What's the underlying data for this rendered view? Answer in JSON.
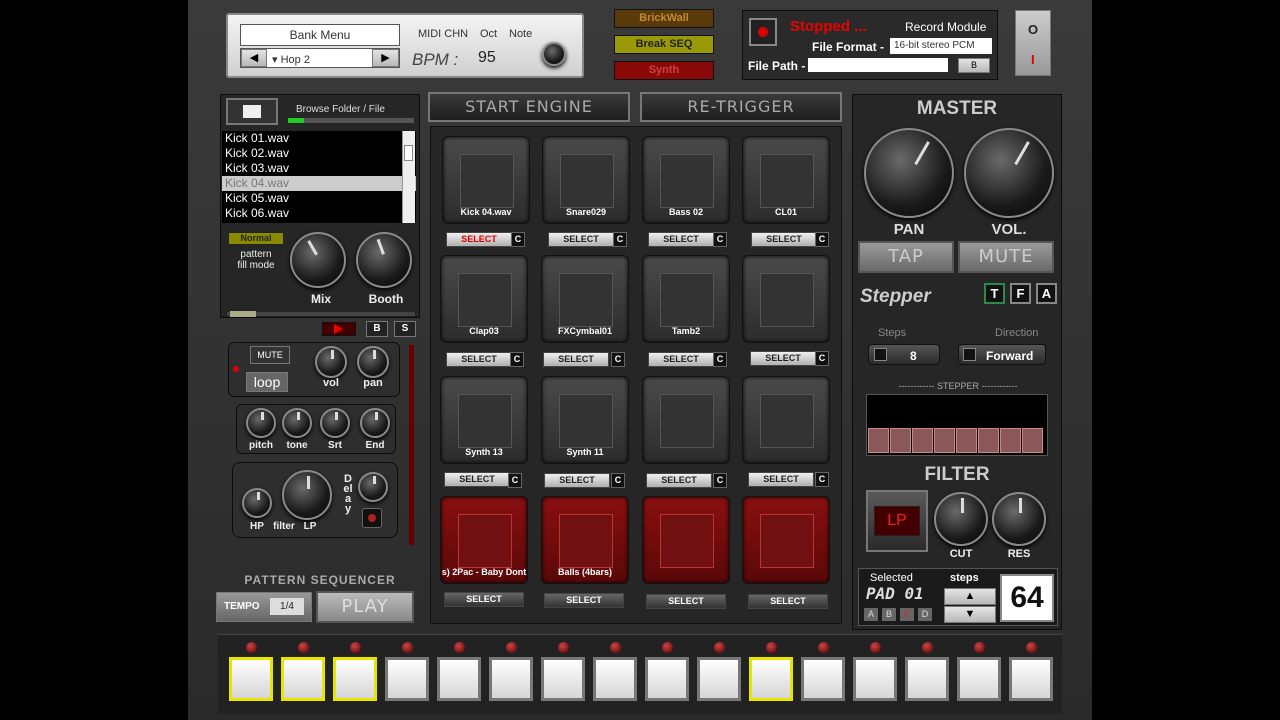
{
  "header": {
    "bank_menu": "Bank Menu",
    "preset": "Hop 2",
    "midi_chn": "MIDI CHN",
    "oct": "Oct",
    "note": "Note",
    "bpm_label": "BPM :",
    "bpm_value": "95",
    "modes": [
      "BrickWall",
      "Break SEQ",
      "Synth"
    ],
    "record_status": "Stopped ...",
    "record_module": "Record Module",
    "file_format_label": "File Format -",
    "file_format_value": "16-bit stereo PCM",
    "file_path_label": "File Path -",
    "file_path_value": "",
    "file_path_btn": "B",
    "power_o": "O",
    "power_i": "I"
  },
  "browser": {
    "browse_label": "Browse Folder / File",
    "files": [
      "Kick 01.wav",
      "Kick 02.wav",
      "Kick 03.wav",
      "Kick 04.wav",
      "Kick 05.wav",
      "Kick 06.wav"
    ],
    "selected_index": 3,
    "fill_mode_value": "Normal",
    "fill_mode_label_1": "pattern",
    "fill_mode_label_2": "fill mode",
    "mix": "Mix",
    "booth": "Booth"
  },
  "sample": {
    "b": "B",
    "s": "S",
    "mute": "MUTE",
    "loop": "loop",
    "vol": "vol",
    "pan": "pan",
    "pitch": "pitch",
    "tone": "tone",
    "srt": "Srt",
    "end": "End",
    "hp": "HP",
    "filter": "filter",
    "lp": "LP",
    "delay": "Delay"
  },
  "transport": {
    "start_engine": "START ENGINE",
    "retrigger": "RE-TRIGGER"
  },
  "pads": [
    {
      "name": "Kick 04.wav",
      "select": "SELECT",
      "c": "C",
      "active": true
    },
    {
      "name": "Snare029",
      "select": "SELECT",
      "c": "C"
    },
    {
      "name": "Bass 02",
      "select": "SELECT",
      "c": "C"
    },
    {
      "name": "CL01",
      "select": "SELECT",
      "c": "C"
    },
    {
      "name": "Clap03",
      "select": "SELECT",
      "c": "C"
    },
    {
      "name": "FXCymbal01",
      "select": "SELECT",
      "c": "C"
    },
    {
      "name": "Tamb2",
      "select": "SELECT",
      "c": "C"
    },
    {
      "name": "",
      "select": "SELECT",
      "c": "C"
    },
    {
      "name": "Synth 13",
      "select": "SELECT",
      "c": "C"
    },
    {
      "name": "Synth 11",
      "select": "SELECT",
      "c": "C"
    },
    {
      "name": "",
      "select": "SELECT",
      "c": "C"
    },
    {
      "name": "",
      "select": "SELECT",
      "c": "C"
    },
    {
      "name": "s) 2Pac - Baby Dont",
      "select": "SELECT"
    },
    {
      "name": "Balls (4bars)",
      "select": "SELECT"
    },
    {
      "name": "",
      "select": "SELECT"
    },
    {
      "name": "",
      "select": "SELECT"
    }
  ],
  "master": {
    "title": "MASTER",
    "pan": "PAN",
    "vol": "VOL.",
    "tap": "TAP",
    "mute": "MUTE",
    "stepper_title": "Stepper",
    "tfa": [
      "T",
      "F",
      "A"
    ],
    "steps_label": "Steps",
    "steps_value": "8",
    "direction_label": "Direction",
    "direction_value": "Forward",
    "stepper_banner": "STEPPER",
    "filter_title": "FILTER",
    "lp": "LP",
    "cut": "CUT",
    "res": "RES",
    "selected_label": "Selected",
    "selected_pad": "PAD 01",
    "banks": [
      "A",
      "B",
      "C",
      "D"
    ],
    "steps_title": "steps",
    "steps_count": "64"
  },
  "sequencer": {
    "title": "PATTERN SEQUENCER",
    "tempo": "TEMPO",
    "tempo_value": "1/4",
    "play": "PLAY",
    "steps_on": [
      true,
      true,
      true,
      false,
      false,
      false,
      false,
      false,
      false,
      false,
      true,
      false,
      false,
      false,
      false,
      false
    ]
  }
}
